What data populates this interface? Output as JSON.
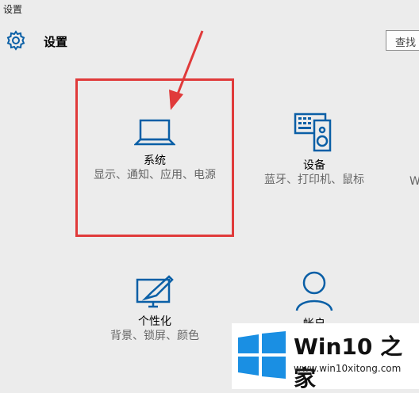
{
  "window": {
    "title": "设置"
  },
  "header": {
    "title": "设置",
    "icon": "gear-icon",
    "search_label": "查找"
  },
  "tiles": [
    {
      "name": "系统",
      "desc": "显示、通知、应用、电源",
      "icon": "laptop-icon"
    },
    {
      "name": "设备",
      "desc": "蓝牙、打印机、鼠标",
      "icon": "devices-icon"
    },
    {
      "name": "个性化",
      "desc": "背景、锁屏、颜色",
      "icon": "personalization-icon"
    },
    {
      "name": "帐户",
      "desc": "",
      "icon": "account-icon"
    }
  ],
  "edge_partial": "W",
  "watermark": {
    "brand": "Win10 之家",
    "url": "www.win10xitong.com"
  },
  "colors": {
    "accent": "#0a5fa6",
    "highlight": "#e03a3a",
    "background": "#ececec"
  }
}
